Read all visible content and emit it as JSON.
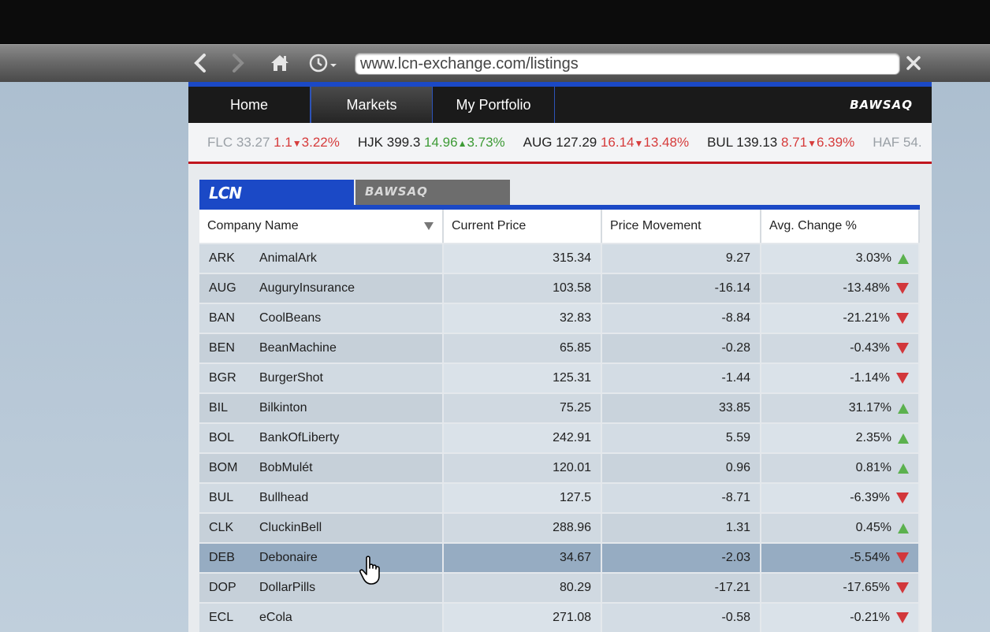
{
  "browser": {
    "url": "www.lcn-exchange.com/listings"
  },
  "site_nav": {
    "tabs": [
      {
        "label": "Home",
        "active": false
      },
      {
        "label": "Markets",
        "active": true
      },
      {
        "label": "My Portfolio",
        "active": false
      }
    ],
    "logo": "BAWSAQ"
  },
  "ticker": [
    {
      "symbol": "FLC",
      "price": "33.27",
      "change": "1.1",
      "dir": "down",
      "pct": "3.22%"
    },
    {
      "symbol": "HJK",
      "price": "399.3",
      "change": "14.96",
      "dir": "up",
      "pct": "3.73%"
    },
    {
      "symbol": "AUG",
      "price": "127.29",
      "change": "16.14",
      "dir": "down",
      "pct": "13.48%"
    },
    {
      "symbol": "BUL",
      "price": "139.13",
      "change": "8.71",
      "dir": "down",
      "pct": "6.39%"
    },
    {
      "symbol": "HAF",
      "price": "54.",
      "change": "",
      "dir": "",
      "pct": ""
    }
  ],
  "exchange_tabs": {
    "lcn": "LCN",
    "bawsaq": "BAWSAQ"
  },
  "table": {
    "headers": [
      "Company Name",
      "Current Price",
      "Price Movement",
      "Avg. Change %"
    ],
    "rows": [
      {
        "sym": "ARK",
        "name": "AnimalArk",
        "price": "315.34",
        "move": "9.27",
        "pct": "3.03%",
        "dir": "up"
      },
      {
        "sym": "AUG",
        "name": "AuguryInsurance",
        "price": "103.58",
        "move": "-16.14",
        "pct": "-13.48%",
        "dir": "down"
      },
      {
        "sym": "BAN",
        "name": "CoolBeans",
        "price": "32.83",
        "move": "-8.84",
        "pct": "-21.21%",
        "dir": "down"
      },
      {
        "sym": "BEN",
        "name": "BeanMachine",
        "price": "65.85",
        "move": "-0.28",
        "pct": "-0.43%",
        "dir": "down"
      },
      {
        "sym": "BGR",
        "name": "BurgerShot",
        "price": "125.31",
        "move": "-1.44",
        "pct": "-1.14%",
        "dir": "down"
      },
      {
        "sym": "BIL",
        "name": "Bilkinton",
        "price": "75.25",
        "move": "33.85",
        "pct": "31.17%",
        "dir": "up"
      },
      {
        "sym": "BOL",
        "name": "BankOfLiberty",
        "price": "242.91",
        "move": "5.59",
        "pct": "2.35%",
        "dir": "up"
      },
      {
        "sym": "BOM",
        "name": "BobMulét",
        "price": "120.01",
        "move": "0.96",
        "pct": "0.81%",
        "dir": "up"
      },
      {
        "sym": "BUL",
        "name": "Bullhead",
        "price": "127.5",
        "move": "-8.71",
        "pct": "-6.39%",
        "dir": "down"
      },
      {
        "sym": "CLK",
        "name": "CluckinBell",
        "price": "288.96",
        "move": "1.31",
        "pct": "0.45%",
        "dir": "up"
      },
      {
        "sym": "DEB",
        "name": "Debonaire",
        "price": "34.67",
        "move": "-2.03",
        "pct": "-5.54%",
        "dir": "down",
        "selected": true
      },
      {
        "sym": "DOP",
        "name": "DollarPills",
        "price": "80.29",
        "move": "-17.21",
        "pct": "-17.65%",
        "dir": "down"
      },
      {
        "sym": "ECL",
        "name": "eCola",
        "price": "271.08",
        "move": "-0.58",
        "pct": "-0.21%",
        "dir": "down"
      }
    ]
  },
  "colors": {
    "accent_blue": "#1b49c6",
    "up": "#5bb14e",
    "down": "#d2373b",
    "ticker_border": "#c0161e"
  }
}
